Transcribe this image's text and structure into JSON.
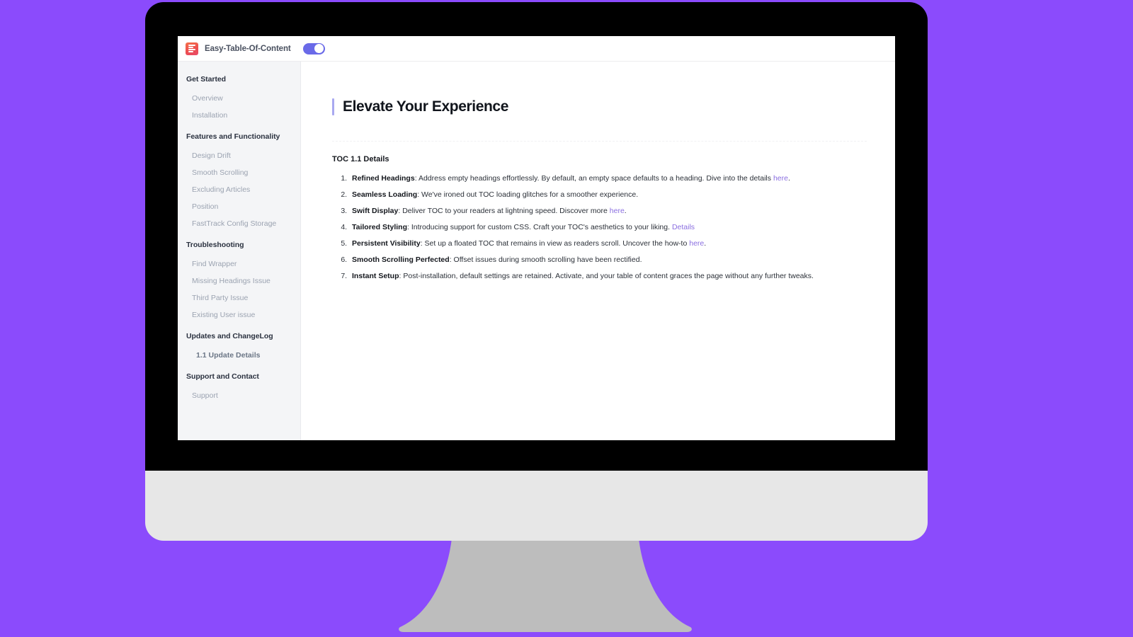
{
  "app": {
    "brand_title": "Easy-Table-Of-Content",
    "logo_icon": "table-of-content-logo-icon",
    "toggle_icon": "toggle-switch-on-icon",
    "toggle_state": "on",
    "accent_color": "#6A6AE8",
    "logo_color": "#ED4E4E",
    "link_color": "#8A6EE0",
    "background_color": "#8B4BFC"
  },
  "sidebar": {
    "groups": [
      {
        "title": "Get Started",
        "items": [
          {
            "label": "Overview",
            "active": false
          },
          {
            "label": "Installation",
            "active": false
          }
        ]
      },
      {
        "title": "Features and Functionality",
        "items": [
          {
            "label": "Design Drift",
            "active": false
          },
          {
            "label": "Smooth Scrolling",
            "active": false
          },
          {
            "label": "Excluding Articles",
            "active": false
          },
          {
            "label": "Position",
            "active": false
          },
          {
            "label": "FastTrack Config Storage",
            "active": false
          }
        ]
      },
      {
        "title": "Troubleshooting",
        "items": [
          {
            "label": "Find Wrapper",
            "active": false
          },
          {
            "label": "Missing Headings Issue",
            "active": false
          },
          {
            "label": "Third Party Issue",
            "active": false
          },
          {
            "label": "Existing User issue",
            "active": false
          }
        ]
      },
      {
        "title": "Updates and ChangeLog",
        "items": [
          {
            "label": "1.1 Update Details",
            "active": true
          }
        ]
      },
      {
        "title": "Support and Contact",
        "items": [
          {
            "label": "Support",
            "active": false
          }
        ]
      }
    ]
  },
  "content": {
    "page_title": "Elevate Your Experience",
    "section_heading": "TOC 1.1 Details",
    "features": [
      {
        "term": "Refined Headings",
        "text_before_link": ": Address empty headings effortlessly. By default, an empty space defaults to a heading. Dive into the details ",
        "link": "here",
        "text_after_link": "."
      },
      {
        "term": "Seamless Loading",
        "text_before_link": ": We've ironed out TOC loading glitches for a smoother experience.",
        "link": "",
        "text_after_link": ""
      },
      {
        "term": "Swift Display",
        "text_before_link": ": Deliver TOC to your readers at lightning speed. Discover more ",
        "link": "here",
        "text_after_link": "."
      },
      {
        "term": "Tailored Styling",
        "text_before_link": ": Introducing support for custom CSS. Craft your TOC's aesthetics to your liking. ",
        "link": "Details",
        "text_after_link": ""
      },
      {
        "term": "Persistent Visibility",
        "text_before_link": ": Set up a floated TOC that remains in view as readers scroll. Uncover the how-to ",
        "link": "here",
        "text_after_link": "."
      },
      {
        "term": "Smooth Scrolling Perfected",
        "text_before_link": ": Offset issues during smooth scrolling have been rectified.",
        "link": "",
        "text_after_link": ""
      },
      {
        "term": "Instant Setup",
        "text_before_link": ": Post-installation, default settings are retained. Activate, and your table of content graces the page without any further tweaks.",
        "link": "",
        "text_after_link": ""
      }
    ]
  }
}
